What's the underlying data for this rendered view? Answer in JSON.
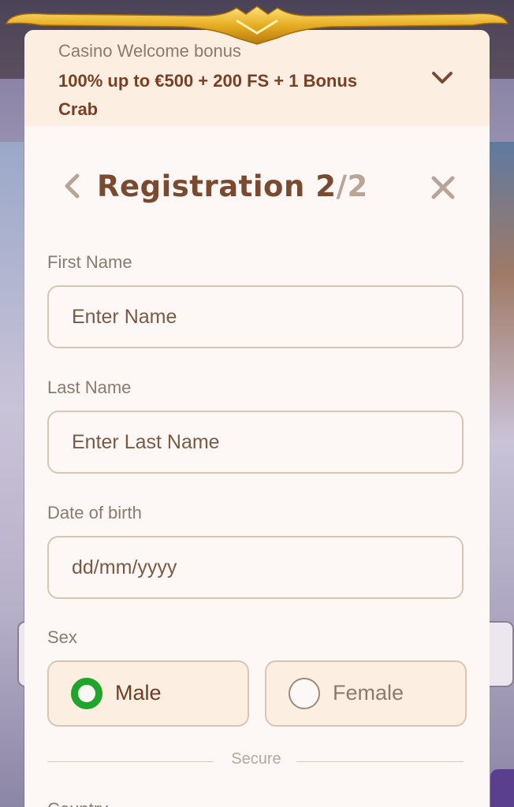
{
  "bonus": {
    "subtitle": "Casino Welcome bonus",
    "title": "100% up to €500 + 200 FS + 1 Bonus Crab"
  },
  "header": {
    "title_main": "Registration 2",
    "title_dim": "/2"
  },
  "form": {
    "first_name": {
      "label": "First Name",
      "placeholder": "Enter Name"
    },
    "last_name": {
      "label": "Last Name",
      "placeholder": "Enter Last Name"
    },
    "dob": {
      "label": "Date of birth",
      "placeholder": "dd/mm/yyyy"
    },
    "sex": {
      "label": "Sex",
      "options": [
        {
          "label": "Male",
          "selected": true
        },
        {
          "label": "Female",
          "selected": false
        }
      ]
    },
    "divider_text": "Secure",
    "country_label": "Country"
  },
  "colors": {
    "accent_title": "#7a4a30",
    "radio_selected": "#1fa52b",
    "bonus_bg": "#fcefe2",
    "modal_bg": "#fdf7f5"
  },
  "icons": {
    "bonus_toggle": "chevron-down-icon",
    "back": "chevron-left-icon",
    "close": "close-icon"
  }
}
